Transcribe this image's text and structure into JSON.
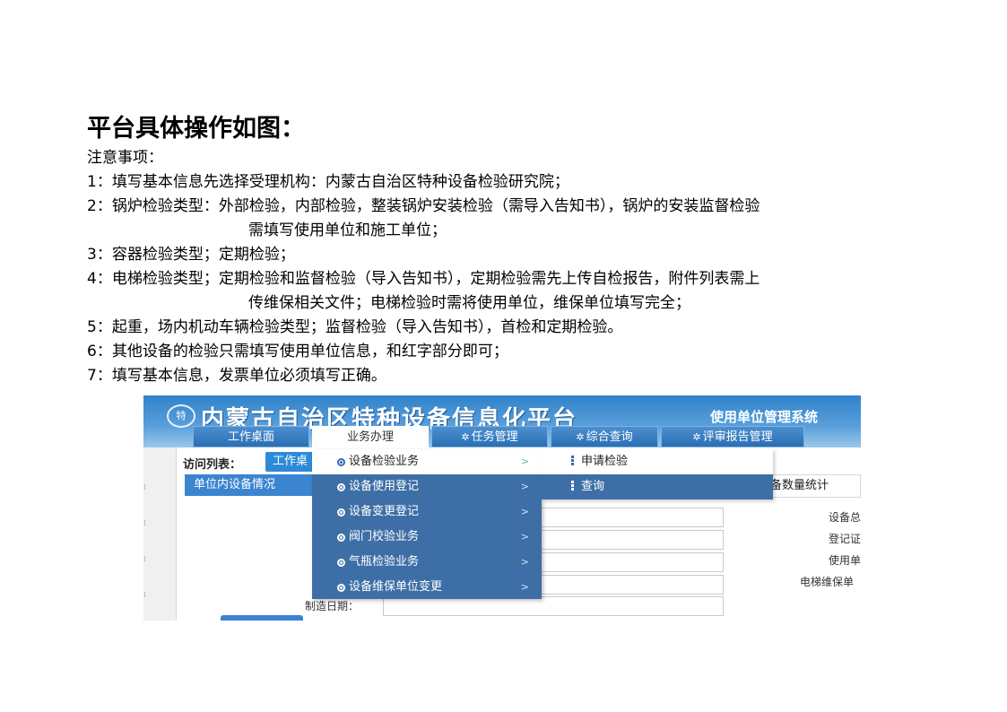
{
  "document": {
    "title": "平台具体操作如图：",
    "notes_header": "注意事项：",
    "notes": [
      {
        "num": "1：",
        "text": "填写基本信息先选择受理机构：内蒙古自治区特种设备检验研究院；"
      },
      {
        "num": "2：",
        "text": "锅炉检验类型：外部检验，内部检验，整装锅炉安装检验（需导入告知书），锅炉的安装监督检验",
        "cont": "需填写使用单位和施工单位；"
      },
      {
        "num": "3：",
        "text": "容器检验类型；定期检验；"
      },
      {
        "num": "4：",
        "text": "电梯检验类型；定期检验和监督检验（导入告知书），定期检验需先上传自检报告，附件列表需上",
        "cont": "传维保相关文件；电梯检验时需将使用单位，维保单位填写完全；"
      },
      {
        "num": "5：",
        "text": "起重，场内机动车辆检验类型；监督检验（导入告知书），首检和定期检验。"
      },
      {
        "num": "6：",
        "text": "其他设备的检验只需填写使用单位信息，和红字部分即可；"
      },
      {
        "num": "7：",
        "text": "填写基本信息，发票单位必须填写正确。"
      }
    ]
  },
  "screenshot": {
    "banner_title": "内蒙古自治区特种设备信息化平台",
    "banner_subtitle": "使用单位管理系统",
    "tabs": [
      "工作桌面",
      "业务办理",
      "任务管理",
      "综合查询",
      "评审报告管理"
    ],
    "visit_label": "访问列表：",
    "visit_chip": "工作桌",
    "panel_left": "单位内设备情况",
    "panel_right": "备数量统计",
    "bottom_label": "制造日期：",
    "right_labels": [
      "设备总",
      "登记证",
      "使用单",
      "电梯维保单"
    ],
    "dropdown_items": [
      "设备检验业务",
      "设备使用登记",
      "设备变更登记",
      "阀门校验业务",
      "气瓶检验业务",
      "设备维保单位变更"
    ],
    "submenu_items": [
      "申请检验",
      "查询"
    ]
  },
  "colors": {
    "banner": "#2f82c9",
    "menu": "#3d6fa6",
    "accent": "#3b84cf"
  }
}
